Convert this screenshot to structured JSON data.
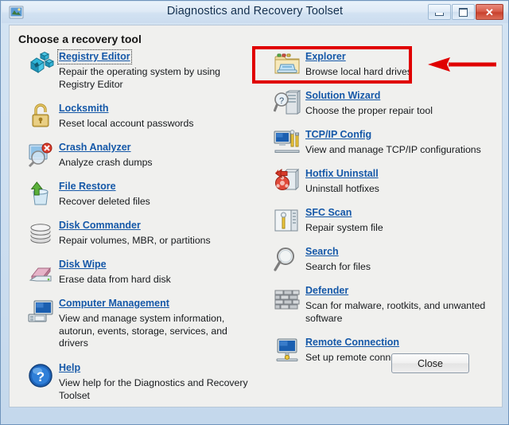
{
  "window": {
    "title": "Diagnostics and Recovery Toolset",
    "app_icon": "app-icon",
    "buttons": {
      "minimize": "minimize-button",
      "maximize": "maximize-button",
      "close": "close-window-button",
      "close_glyph": "✕"
    }
  },
  "content": {
    "heading": "Choose a recovery tool",
    "close_button_label": "Close"
  },
  "tools": {
    "left": [
      {
        "name": "Registry Editor",
        "description": "Repair the operating system by using Registry Editor",
        "icon": "registry-editor-icon",
        "focused": true
      },
      {
        "name": "Locksmith",
        "description": "Reset local account passwords",
        "icon": "padlock-icon",
        "focused": false
      },
      {
        "name": "Crash Analyzer",
        "description": "Analyze crash dumps",
        "icon": "magnifier-error-icon",
        "focused": false
      },
      {
        "name": "File Restore",
        "description": "Recover deleted files",
        "icon": "recycle-bin-restore-icon",
        "focused": false
      },
      {
        "name": "Disk Commander",
        "description": "Repair volumes, MBR, or partitions",
        "icon": "disk-stack-icon",
        "focused": false
      },
      {
        "name": "Disk Wipe",
        "description": "Erase data from hard disk",
        "icon": "eraser-disk-icon",
        "focused": false
      },
      {
        "name": "Computer Management",
        "description": "View and manage system information, autorun, events, storage, services, and drivers",
        "icon": "computer-monitor-icon",
        "focused": false
      },
      {
        "name": "Help",
        "description": "View help for the Diagnostics and Recovery Toolset",
        "icon": "question-mark-icon",
        "focused": false
      }
    ],
    "right": [
      {
        "name": "Explorer",
        "description": "Browse local hard drives",
        "icon": "folder-explorer-icon",
        "focused": false
      },
      {
        "name": "Solution Wizard",
        "description": "Choose the proper repair tool",
        "icon": "server-magnifier-icon",
        "focused": false
      },
      {
        "name": "TCP/IP Config",
        "description": "View and manage TCP/IP configurations",
        "icon": "monitor-tools-icon",
        "focused": false
      },
      {
        "name": "Hotfix Uninstall",
        "description": "Uninstall hotfixes",
        "icon": "hotfix-rollback-icon",
        "focused": false
      },
      {
        "name": "SFC Scan",
        "description": "Repair system file",
        "icon": "server-wrench-icon",
        "focused": false
      },
      {
        "name": "Search",
        "description": "Search for files",
        "icon": "magnifier-icon",
        "focused": false
      },
      {
        "name": "Defender",
        "description": "Scan for malware, rootkits, and unwanted software",
        "icon": "firewall-brick-icon",
        "focused": false
      },
      {
        "name": "Remote Connection",
        "description": "Set up remote connections",
        "icon": "remote-monitor-icon",
        "focused": false
      }
    ]
  },
  "annotations": {
    "highlight_box": {
      "target": "Explorer",
      "color": "#e00000"
    },
    "arrow": {
      "direction": "left",
      "color": "#e00000"
    }
  },
  "colors": {
    "link": "#1558a8",
    "window_frame": "#c9dcee",
    "client_background": "#f0f0ee",
    "annotation": "#e00000"
  }
}
